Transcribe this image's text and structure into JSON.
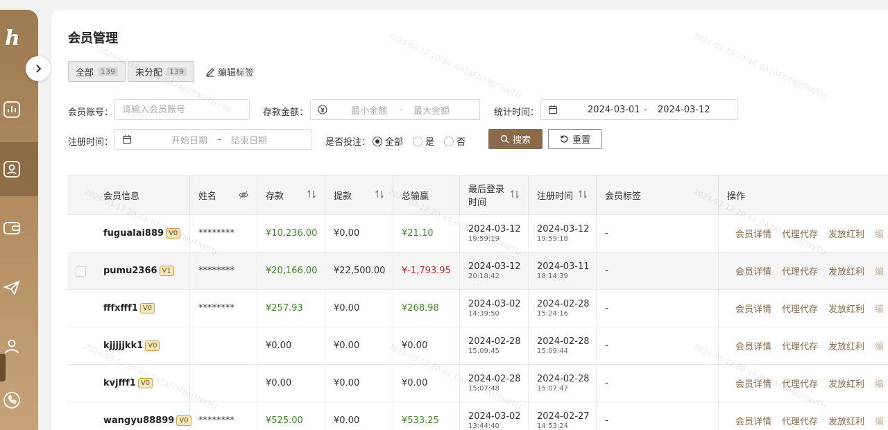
{
  "page": {
    "title": "会员管理",
    "tabs": [
      {
        "label": "全部",
        "count": "139"
      },
      {
        "label": "未分配",
        "count": "139"
      }
    ],
    "edit_tags": "编辑标签"
  },
  "filters": {
    "account": {
      "label": "会员账号：",
      "placeholder": "请输入会员账号"
    },
    "deposit": {
      "label": "存款金额：",
      "min_placeholder": "最小金额",
      "separator": "-",
      "max_placeholder": "最大金额"
    },
    "stats_time": {
      "label": "统计时间：",
      "start": "2024-03-01",
      "separator": "-",
      "end": "2024-03-12"
    },
    "register_time": {
      "label": "注册时间：",
      "start_placeholder": "开始日期",
      "separator": "-",
      "end_placeholder": "结束日期"
    },
    "bet": {
      "label": "是否投注：",
      "options": [
        "全部",
        "是",
        "否"
      ],
      "selected": "全部"
    },
    "search_button": "搜索",
    "reset_button": "重置"
  },
  "table": {
    "columns": [
      "会员信息",
      "姓名",
      "存款",
      "提款",
      "总输赢",
      "最后登录时间",
      "注册时间",
      "会员标签",
      "操作"
    ],
    "last_login_header": [
      "最后登录",
      "时间"
    ],
    "rows": [
      {
        "account": "fugualai889",
        "vip": "V0",
        "name": "********",
        "deposit": "¥10,236.00",
        "withdraw": "¥0.00",
        "winloss": "¥21.10",
        "winloss_type": "pos",
        "last_login_date": "2024-03-12",
        "last_login_time": "19:59:19",
        "register_date": "2024-03-12",
        "register_time": "19:59:18",
        "tag": "-"
      },
      {
        "account": "pumu2366",
        "vip": "V1",
        "name": "********",
        "deposit": "¥20,166.00",
        "withdraw": "¥22,500.00",
        "winloss": "¥-1,793.95",
        "winloss_type": "neg",
        "last_login_date": "2024-03-12",
        "last_login_time": "20:18:42",
        "register_date": "2024-03-11",
        "register_time": "18:14:39",
        "tag": "-"
      },
      {
        "account": "fffxfff1",
        "vip": "V0",
        "name": "********",
        "deposit": "¥257.93",
        "withdraw": "¥0.00",
        "winloss": "¥268.98",
        "winloss_type": "pos",
        "last_login_date": "2024-03-02",
        "last_login_time": "14:39:50",
        "register_date": "2024-02-28",
        "register_time": "15:24:16",
        "tag": "-"
      },
      {
        "account": "kjjjjjkk1",
        "vip": "V0",
        "name": "",
        "deposit": "¥0.00",
        "withdraw": "¥0.00",
        "winloss": "¥0.00",
        "winloss_type": "zero",
        "last_login_date": "2024-02-28",
        "last_login_time": "15:09:45",
        "register_date": "2024-02-28",
        "register_time": "15:09:44",
        "tag": "-"
      },
      {
        "account": "kvjfff1",
        "vip": "V0",
        "name": "",
        "deposit": "¥0.00",
        "withdraw": "¥0.00",
        "winloss": "¥0.00",
        "winloss_type": "zero",
        "last_login_date": "2024-02-28",
        "last_login_time": "15:07:48",
        "register_date": "2024-02-28",
        "register_time": "15:07:47",
        "tag": "-"
      },
      {
        "account": "wangyu88899",
        "vip": "V0",
        "name": "********",
        "deposit": "¥525.00",
        "withdraw": "¥0.00",
        "winloss": "¥533.25",
        "winloss_type": "pos",
        "last_login_date": "2024-03-02",
        "last_login_time": "13:44:40",
        "register_date": "2024-02-27",
        "register_time": "14:53:24",
        "tag": "-"
      }
    ],
    "actions": [
      "会员详情",
      "代理代存",
      "发放红利",
      "编"
    ]
  },
  "watermark": "2024-03-12 20:44_0A7AEOTNUTNVTU",
  "colors": {
    "sidebar_top": "#9c7a52",
    "sidebar_bottom": "#c9a37a",
    "accent": "#8a6a4a",
    "positive": "#3e8a2a",
    "negative": "#c0292a",
    "vip_badge": "#f5e6bd"
  },
  "sidebar_icons": [
    "logo-h",
    "chart-icon",
    "user-card-icon",
    "wallet-icon",
    "send-icon",
    "person-icon",
    "phone-icon"
  ]
}
